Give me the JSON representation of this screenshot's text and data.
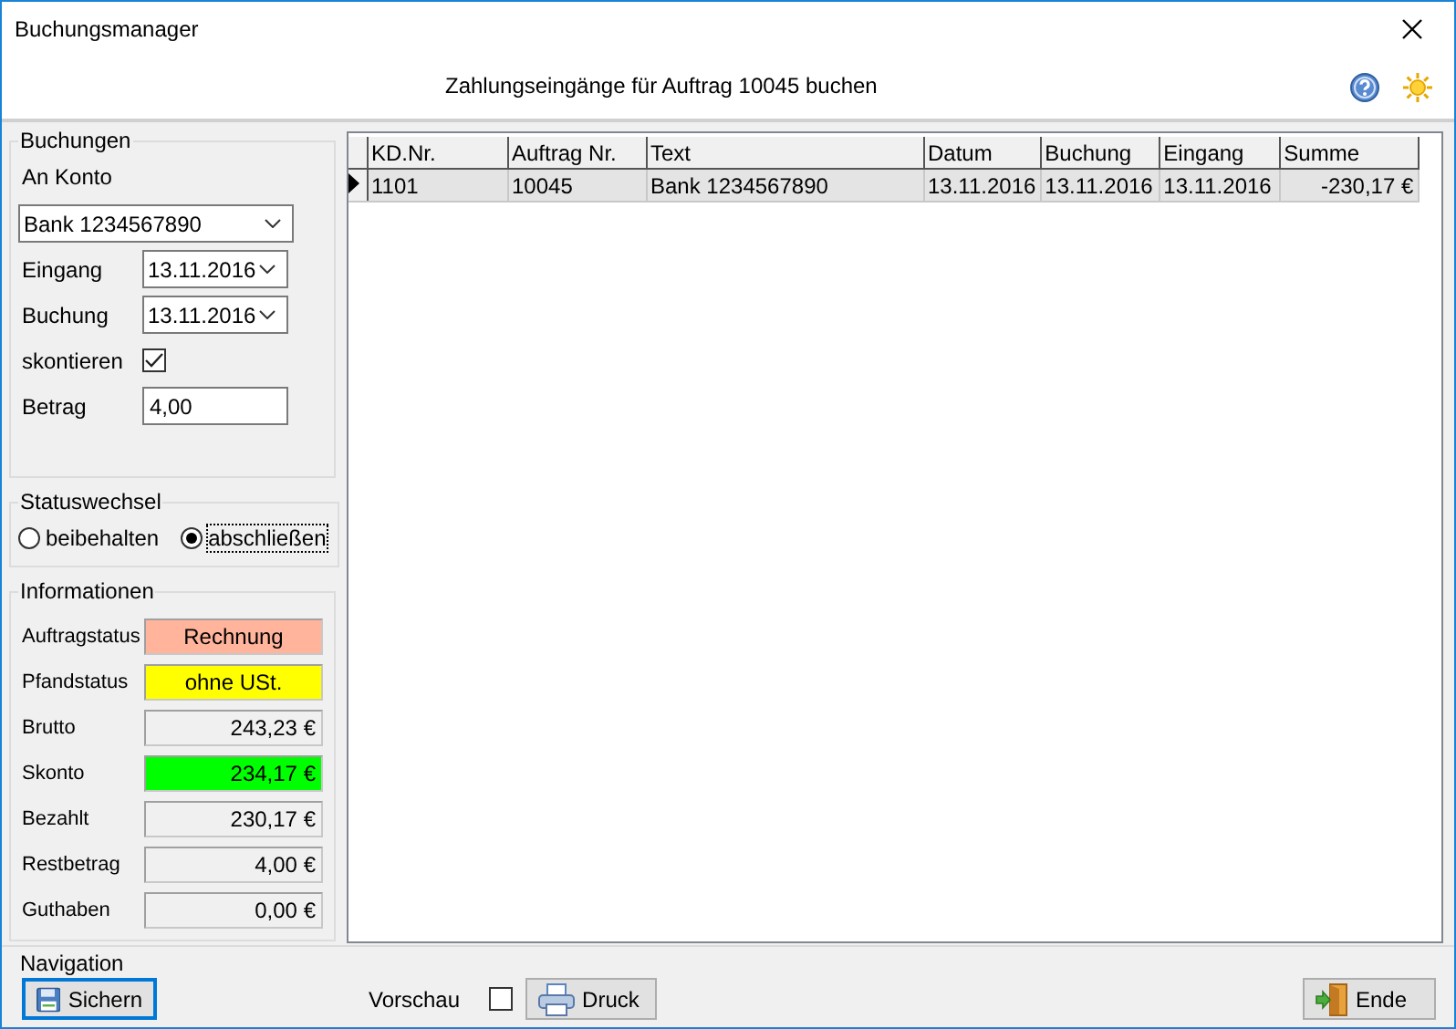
{
  "window": {
    "title": "Buchungsmanager"
  },
  "header": {
    "subtitle": "Zahlungseingänge für Auftrag 10045 buchen"
  },
  "buchungen": {
    "title": "Buchungen",
    "konto_label": "An Konto",
    "konto": "Bank 1234567890",
    "dates": [
      {
        "label": "Eingang",
        "value": "13.11.2016"
      },
      {
        "label": "Buchung",
        "value": "13.11.2016"
      }
    ],
    "skontieren": {
      "label": "skontieren",
      "checked": true
    },
    "betrag": {
      "label": "Betrag",
      "value": "4,00"
    }
  },
  "statuswechsel": {
    "title": "Statuswechsel",
    "options": [
      {
        "label": "beibehalten",
        "selected": false
      },
      {
        "label": "abschließen",
        "selected": true
      }
    ]
  },
  "informationen": {
    "title": "Informationen",
    "rows": [
      {
        "label": "Auftragstatus",
        "value": "Rechnung",
        "kind": "status",
        "color": "#ffb49b"
      },
      {
        "label": "Pfandstatus",
        "value": "ohne USt.",
        "kind": "status",
        "color": "#ffff00"
      },
      {
        "label": "Brutto",
        "value": "243,23 €",
        "kind": "amount"
      },
      {
        "label": "Skonto",
        "value": "234,17 €",
        "kind": "amount",
        "color": "#00ff00"
      },
      {
        "label": "Bezahlt",
        "value": "230,17 €",
        "kind": "amount"
      },
      {
        "label": "Restbetrag",
        "value": "4,00 €",
        "kind": "amount"
      },
      {
        "label": "Guthaben",
        "value": "0,00 €",
        "kind": "amount"
      }
    ]
  },
  "table": {
    "columns": [
      "KD.Nr.",
      "Auftrag Nr.",
      "Text",
      "Datum",
      "Buchung",
      "Eingang",
      "Summe"
    ],
    "rows": [
      {
        "selected": true,
        "cells": [
          "1101",
          "10045",
          "Bank 1234567890",
          "13.11.2016",
          "13.11.2016",
          "13.11.2016",
          "-230,17 €"
        ]
      }
    ]
  },
  "navigation": {
    "title": "Navigation",
    "save": "Sichern",
    "vorschau": {
      "label": "Vorschau",
      "checked": false
    },
    "print": "Druck",
    "end": "Ende"
  }
}
